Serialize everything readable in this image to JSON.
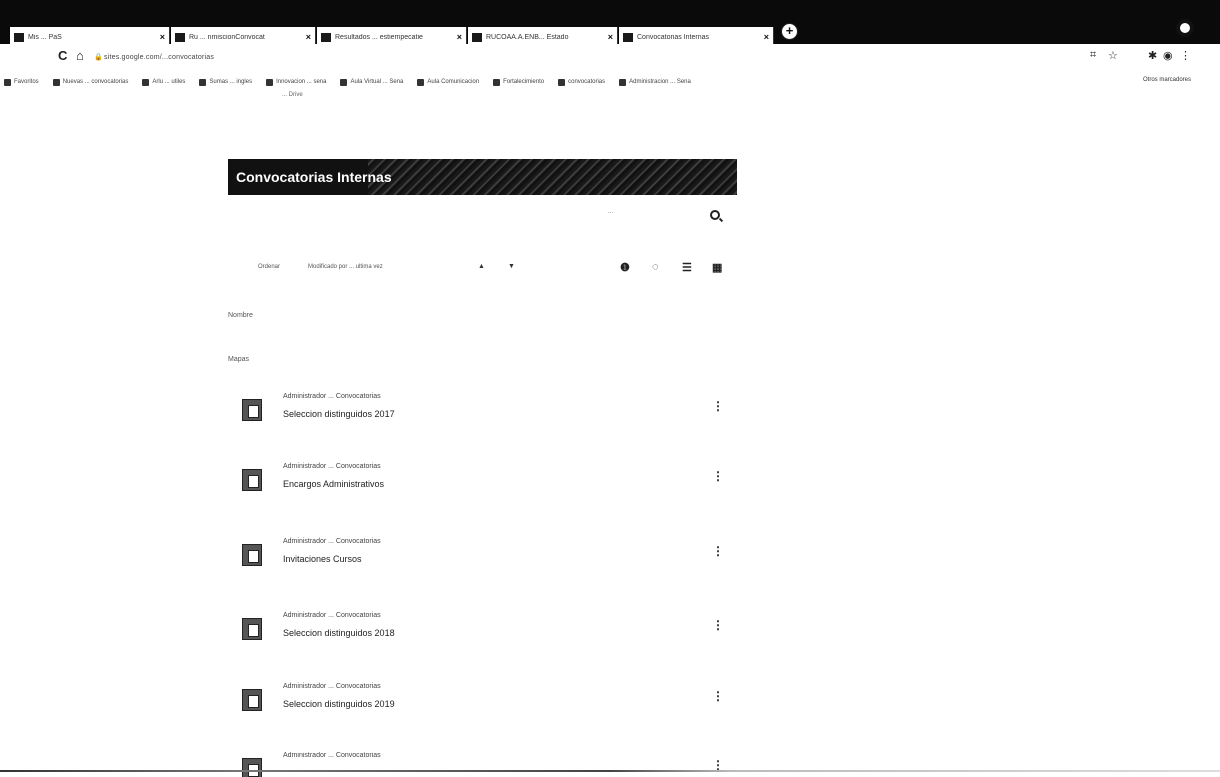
{
  "browser": {
    "tabs": [
      {
        "title": "Mis ... PaS",
        "icon": "sheet-icon"
      },
      {
        "title": "Ru ... nmiscionConvocat",
        "icon": "sheet-icon"
      },
      {
        "title": "Resultados ... estiempecatie",
        "icon": "doc-icon"
      },
      {
        "title": "RUCOAA.A.ENB... Estado",
        "icon": "drive-icon"
      },
      {
        "title": "Convocatorias Internas",
        "icon": "sheet-icon"
      }
    ],
    "url": "sites.google.com/...convocatorias",
    "bookmarks": [
      "Favoritos",
      "Nuevas ... convocatorias",
      "Arlu ... utiles",
      "Sumas ... ingles",
      "Innovacion ... sena",
      "Aula Virtual ... Sena",
      "Aula Comunicacion",
      "Fortalecimiento",
      "convocatorias",
      "Administracion ... Sena"
    ],
    "bookmarks_more": "Otros marcadores",
    "bookmarks_sub": "... Drive"
  },
  "page": {
    "title": "Convocatorias Internas",
    "search_placeholder": "...",
    "sort_label": "Ordenar",
    "sort_value": "Modificado por ... ultima vez",
    "section_folders": "Nombre",
    "section_files": "Mapas"
  },
  "items": [
    {
      "owner": "Administrador ... Convocatorias",
      "name": "Seleccion distinguidos 2017"
    },
    {
      "owner": "Administrador ... Convocatorias",
      "name": "Encargos Administrativos"
    },
    {
      "owner": "Administrador ... Convocatorias",
      "name": "Invitaciones Cursos"
    },
    {
      "owner": "Administrador ... Convocatorias",
      "name": "Seleccion distinguidos 2018"
    },
    {
      "owner": "Administrador ... Convocatorias",
      "name": "Seleccion distinguidos 2019"
    },
    {
      "owner": "Administrador ... Convocatorias",
      "name": ""
    }
  ]
}
